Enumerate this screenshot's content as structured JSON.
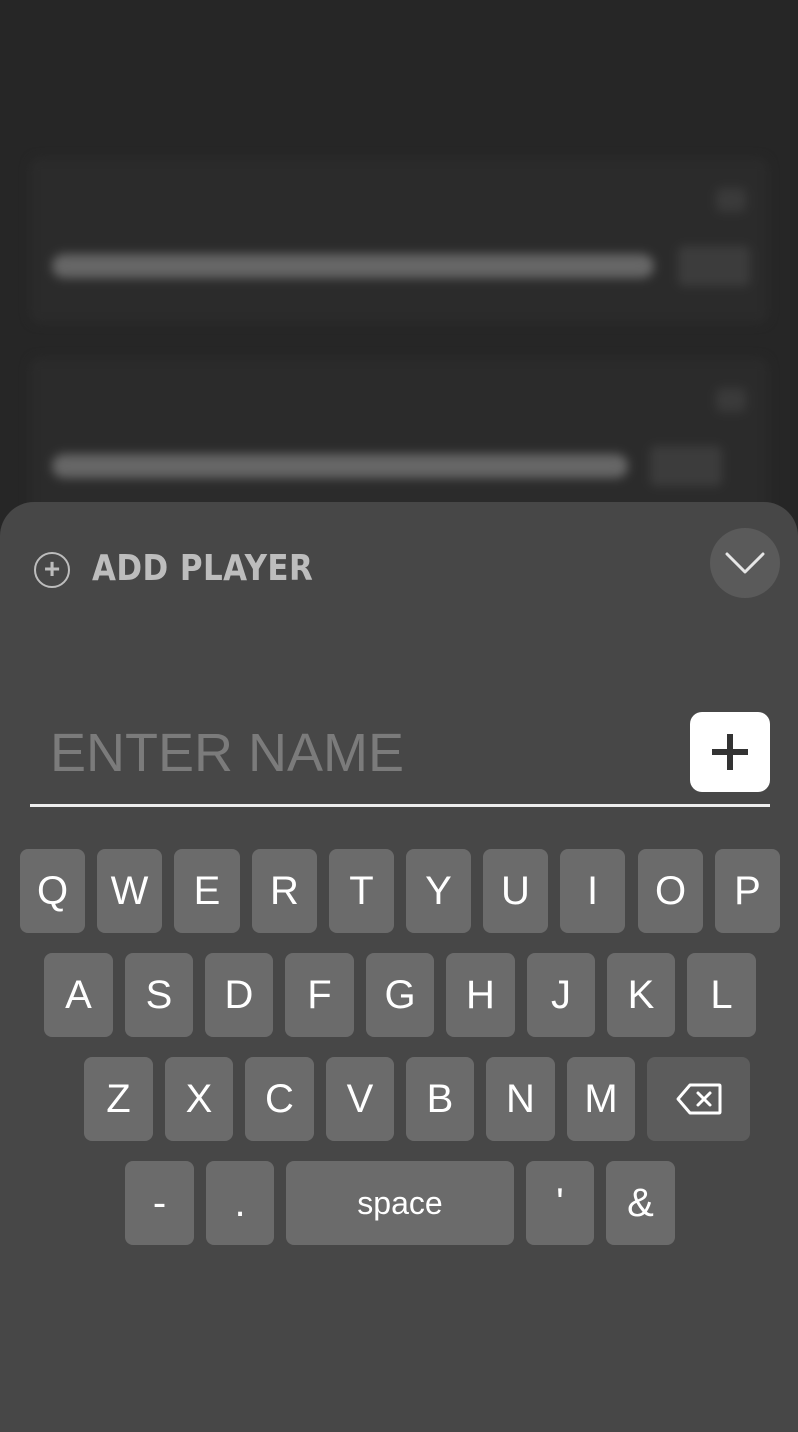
{
  "sheet": {
    "title": "ADD PLAYER",
    "add_icon_glyph": "+",
    "collapse_icon": "chevron-down-icon"
  },
  "name_input": {
    "placeholder": "ENTER NAME",
    "value": ""
  },
  "submit_icon": "plus-icon",
  "keyboard": {
    "row1": [
      "Q",
      "W",
      "E",
      "R",
      "T",
      "Y",
      "U",
      "I",
      "O",
      "P"
    ],
    "row2": [
      "A",
      "S",
      "D",
      "F",
      "G",
      "H",
      "J",
      "K",
      "L"
    ],
    "row3": [
      "Z",
      "X",
      "C",
      "V",
      "B",
      "N",
      "M"
    ],
    "backspace_icon": "backspace-icon",
    "row4": [
      "-",
      ".",
      "space",
      "'",
      "&"
    ]
  },
  "colors": {
    "backdrop": "#262626",
    "sheet": "#474747",
    "key": "#6b6b6b",
    "key_text": "#ffffff",
    "title": "#bdbdbd",
    "placeholder": "#7b7b7b"
  }
}
